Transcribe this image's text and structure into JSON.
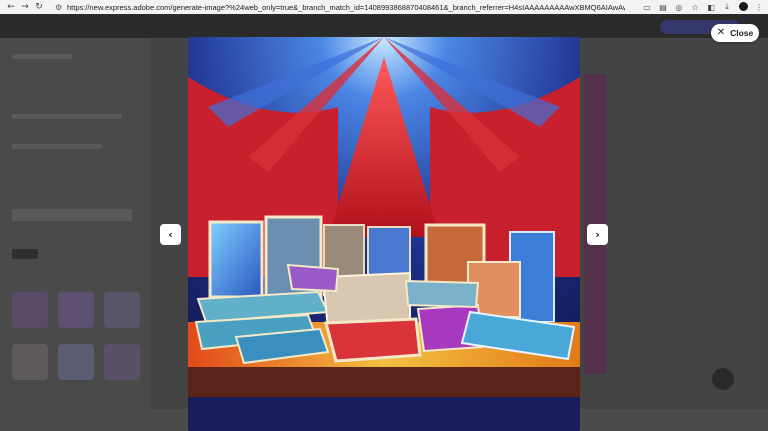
{
  "browser": {
    "url": "https://new.express.adobe.com/generate-image?%24web_only=true&_branch_match_id=1408993868870408461&_branch_referrer=H4sIAAAAAAAAAwXBMQ6AIAwAwBd8zcT4%2BCoLn7AUK1C...",
    "icons": {
      "back": "arrow-left-icon",
      "forward": "arrow-right-icon",
      "reload": "reload-icon",
      "site_info": "tune-icon"
    }
  },
  "modal": {
    "close_label": "Close",
    "close_glyph": "✕",
    "prev_glyph": "‹",
    "next_glyph": "›"
  },
  "image": {
    "subject": "generated-image-books-on-stage",
    "colors": {
      "sky_top": "#1d2f8a",
      "sky_light": "#9fd6ff",
      "curtain_red": "#c8202c",
      "stage_yellow": "#e8b23a",
      "stage_floor": "#5a2418"
    }
  }
}
